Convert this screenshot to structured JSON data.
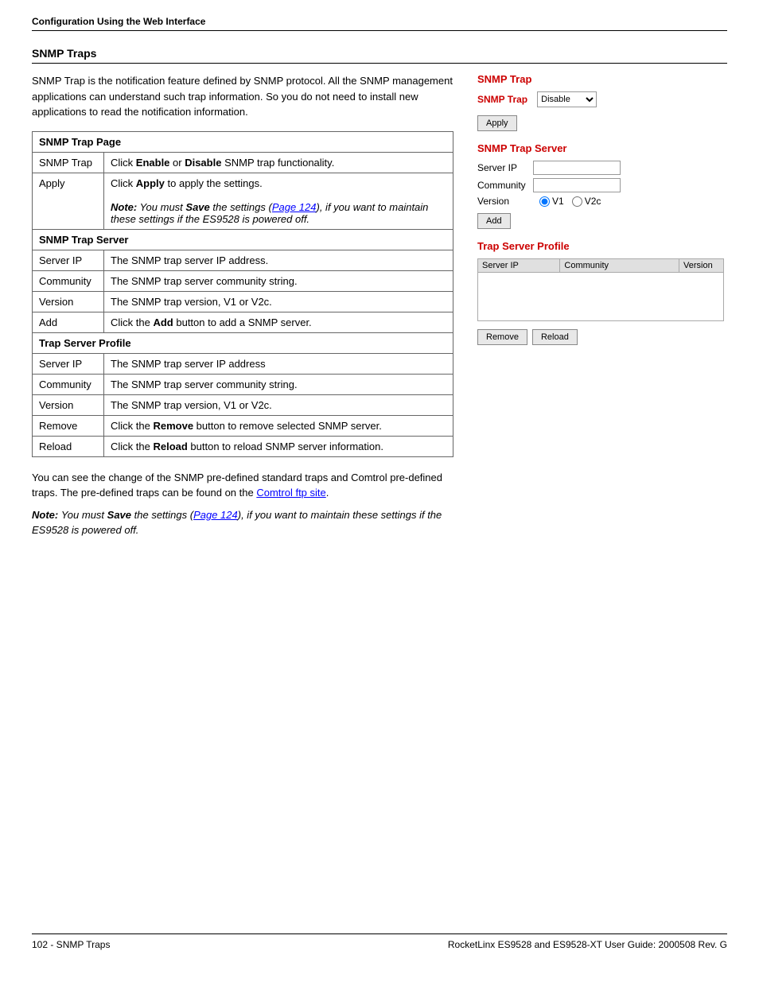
{
  "header": {
    "text": "Configuration Using the Web Interface"
  },
  "section": {
    "title": "SNMP Traps"
  },
  "intro": {
    "paragraph": "SNMP Trap is the notification feature defined by SNMP protocol. All the SNMP management applications can understand such trap information. So you do not need to install new applications to read the notification information."
  },
  "table": {
    "groups": [
      {
        "name": "SNMP Trap Page",
        "rows": [
          {
            "label": "SNMP Trap",
            "description_html": "Click <b>Enable</b> or <b>Disable</b> SNMP trap functionality."
          },
          {
            "label": "Apply",
            "description_html": "Click <b>Apply</b> to apply the settings.<br><br><i><b>Note:</b> You must <b>Save</b> the settings (<u>Page 124</u>), if you want to maintain these settings if the ES9528 is powered off.</i>"
          }
        ]
      },
      {
        "name": "SNMP Trap Server",
        "rows": [
          {
            "label": "Server IP",
            "description": "The SNMP trap server IP address."
          },
          {
            "label": "Community",
            "description": "The SNMP trap server community string."
          },
          {
            "label": "Version",
            "description": "The SNMP trap version, V1 or V2c."
          },
          {
            "label": "Add",
            "description_html": "Click the <b>Add</b> button to add a SNMP server."
          }
        ]
      },
      {
        "name": "Trap Server Profile",
        "rows": [
          {
            "label": "Server IP",
            "description": "The SNMP trap server IP address"
          },
          {
            "label": "Community",
            "description": "The SNMP trap server community string."
          },
          {
            "label": "Version",
            "description": "The SNMP trap version, V1 or V2c."
          },
          {
            "label": "Remove",
            "description_html": "Click the <b>Remove</b> button to remove selected SNMP server."
          },
          {
            "label": "Reload",
            "description_html": "Click the <b>Reload</b> button to reload SNMP server information."
          }
        ]
      }
    ]
  },
  "bottom_note": {
    "prefix": "You can see the change of the SNMP pre-defined standard traps and Comtrol pre-defined traps. The pre-defined traps can be found on the ",
    "link_text": "Comtrol ftp site",
    "suffix": "."
  },
  "bottom_note2": {
    "note_label": "Note:",
    "note_body": " You must ",
    "save_label": "Save",
    "note_body2": " the settings (",
    "page_link": "Page 124",
    "note_body3": "), if you want to maintain these settings if the ES9528 is powered off."
  },
  "right_panel": {
    "snmp_trap_section": {
      "title": "SNMP Trap",
      "trap_label": "SNMP Trap",
      "dropdown_value": "Disable",
      "apply_label": "Apply"
    },
    "snmp_trap_server": {
      "title": "SNMP Trap Server",
      "server_ip_label": "Server IP",
      "server_ip_value": "",
      "community_label": "Community",
      "community_value": "",
      "version_label": "Version",
      "v1_label": "V1",
      "v2c_label": "V2c",
      "add_label": "Add"
    },
    "trap_server_profile": {
      "title": "Trap Server Profile",
      "col_server_ip": "Server IP",
      "col_community": "Community",
      "col_version": "Version",
      "remove_label": "Remove",
      "reload_label": "Reload"
    }
  },
  "footer": {
    "left": "102 - SNMP Traps",
    "right": "RocketLinx ES9528 and ES9528-XT User Guide: 2000508 Rev. G"
  }
}
